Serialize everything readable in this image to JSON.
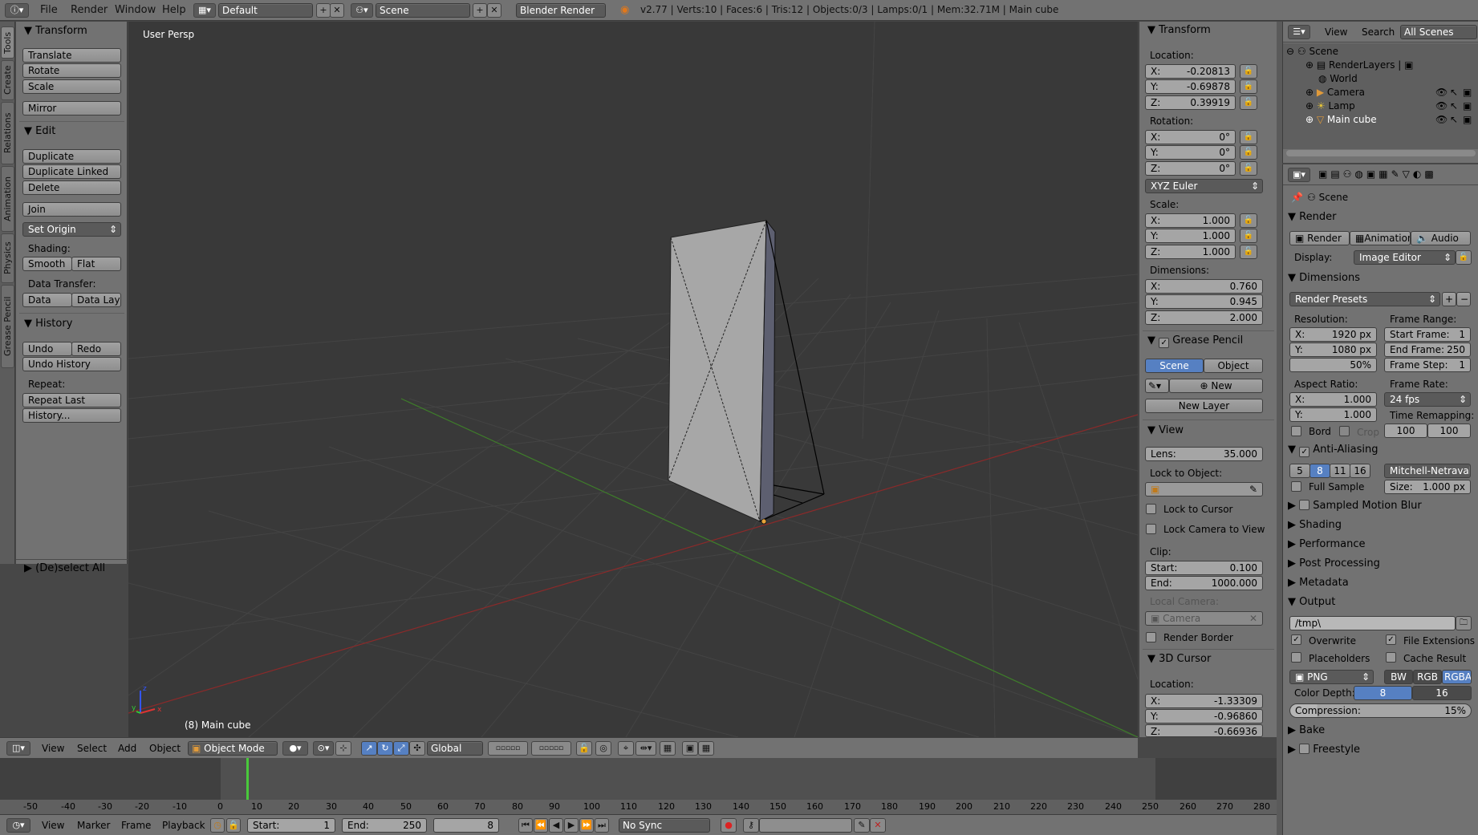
{
  "topbar": {
    "menus": [
      "File",
      "Render",
      "Window",
      "Help"
    ],
    "layout": "Default",
    "scene": "Scene",
    "engine": "Blender Render",
    "stats": "v2.77 | Verts:10 | Faces:6 | Tris:12 | Objects:0/3 | Lamps:0/1 | Mem:32.71M | Main cube"
  },
  "left_tabs": [
    "Tools",
    "Create",
    "Relations",
    "Animation",
    "Physics",
    "Grease Pencil"
  ],
  "tools": {
    "transform_header": "Transform",
    "translate": "Translate",
    "rotate": "Rotate",
    "scale": "Scale",
    "mirror": "Mirror",
    "edit_header": "Edit",
    "duplicate": "Duplicate",
    "duplicate_linked": "Duplicate Linked",
    "delete": "Delete",
    "join": "Join",
    "set_origin": "Set Origin",
    "shading_label": "Shading:",
    "smooth": "Smooth",
    "flat": "Flat",
    "data_transfer_label": "Data Transfer:",
    "data": "Data",
    "data_layo": "Data Layo",
    "history_header": "History",
    "undo": "Undo",
    "redo": "Redo",
    "undo_history": "Undo History",
    "repeat_label": "Repeat:",
    "repeat_last": "Repeat Last",
    "history": "History...",
    "deselect_all": "(De)select All"
  },
  "viewport": {
    "view_name": "User Persp",
    "object_label": "(8) Main cube"
  },
  "props": {
    "transform_header": "Transform",
    "location_label": "Location:",
    "loc": [
      "-0.20813",
      "-0.69878",
      "0.39919"
    ],
    "rotation_label": "Rotation:",
    "rot": [
      "0°",
      "0°",
      "0°"
    ],
    "rot_mode": "XYZ Euler",
    "scale_label": "Scale:",
    "scale": [
      "1.000",
      "1.000",
      "1.000"
    ],
    "dimensions_label": "Dimensions:",
    "dims": [
      "0.760",
      "0.945",
      "2.000"
    ],
    "gp_header": "Grease Pencil",
    "gp_scene": "Scene",
    "gp_object": "Object",
    "gp_new": "New",
    "gp_new_layer": "New Layer",
    "view_header": "View",
    "lens_label": "Lens:",
    "lens": "35.000",
    "lock_to_object": "Lock to Object:",
    "lock_to_cursor": "Lock to Cursor",
    "lock_camera": "Lock Camera to View",
    "clip_label": "Clip:",
    "clip_start_label": "Start:",
    "clip_start": "0.100",
    "clip_end_label": "End:",
    "clip_end": "1000.000",
    "local_camera": "Local Camera:",
    "camera": "Camera",
    "render_border": "Render Border",
    "cursor_header": "3D Cursor",
    "cursor_location": "Location:",
    "cursor": [
      "-1.33309",
      "-0.96860",
      "-0.66936"
    ],
    "axes": [
      "X:",
      "Y:",
      "Z:"
    ]
  },
  "outliner": {
    "view": "View",
    "search": "Search",
    "scenes": "All Scenes",
    "items": [
      "Scene",
      "RenderLayers",
      "World",
      "Camera",
      "Lamp",
      "Main cube"
    ]
  },
  "render": {
    "scene": "Scene",
    "render_header": "Render",
    "render_btn": "Render",
    "animation_btn": "Animation",
    "audio_btn": "Audio",
    "display_label": "Display:",
    "display": "Image Editor",
    "dimensions_header": "Dimensions",
    "presets": "Render Presets",
    "resolution_label": "Resolution:",
    "res_x": "1920 px",
    "res_y": "1080 px",
    "res_pct": "50%",
    "frame_range_label": "Frame Range:",
    "start_frame_label": "Start Frame:",
    "start_frame": "1",
    "end_frame_label": "End Frame:",
    "end_frame": "250",
    "frame_step_label": "Frame Step:",
    "frame_step": "1",
    "aspect_label": "Aspect Ratio:",
    "aspect_x": "1.000",
    "aspect_y": "1.000",
    "frame_rate_label": "Frame Rate:",
    "fps": "24 fps",
    "bord": "Bord",
    "crop": "Crop",
    "time_remap_label": "Time Remapping:",
    "remap_old": "100",
    "remap_new": "100",
    "aa_header": "Anti-Aliasing",
    "aa_samples": [
      "5",
      "8",
      "11",
      "16"
    ],
    "aa_filter": "Mitchell-Netravali",
    "full_sample": "Full Sample",
    "size_label": "Size:",
    "size": "1.000 px",
    "motion_blur": "Sampled Motion Blur",
    "shading": "Shading",
    "performance": "Performance",
    "post_processing": "Post Processing",
    "metadata": "Metadata",
    "output": "Output",
    "path": "/tmp\\",
    "overwrite": "Overwrite",
    "file_extensions": "File Extensions",
    "placeholders": "Placeholders",
    "cache_result": "Cache Result",
    "format": "PNG",
    "bw": "BW",
    "rgb": "RGB",
    "rgba": "RGBA",
    "color_depth_label": "Color Depth:",
    "depth_8": "8",
    "depth_16": "16",
    "compression_label": "Compression:",
    "compression": "15%",
    "bake": "Bake",
    "freestyle": "Freestyle"
  },
  "view_header": {
    "view": "View",
    "select": "Select",
    "add": "Add",
    "object": "Object",
    "mode": "Object Mode",
    "orientation": "Global"
  },
  "timeline": {
    "ticks": [
      "-50",
      "-40",
      "-30",
      "-20",
      "-10",
      "0",
      "10",
      "20",
      "30",
      "40",
      "50",
      "60",
      "70",
      "80",
      "90",
      "100",
      "110",
      "120",
      "130",
      "140",
      "150",
      "160",
      "170",
      "180",
      "190",
      "200",
      "210",
      "220",
      "230",
      "240",
      "250",
      "260",
      "270",
      "280"
    ],
    "current_frame": 8,
    "view": "View",
    "marker": "Marker",
    "frame": "Frame",
    "playback": "Playback",
    "start_label": "Start:",
    "start": "1",
    "end_label": "End:",
    "end": "250",
    "current": "8",
    "sync": "No Sync"
  },
  "colors": {
    "selected": "#5680c2",
    "panel": "#727272",
    "viewport": "#393939",
    "x_axis": "#8b2a2a",
    "y_axis": "#3e7d2a",
    "playhead": "#49c93b"
  }
}
